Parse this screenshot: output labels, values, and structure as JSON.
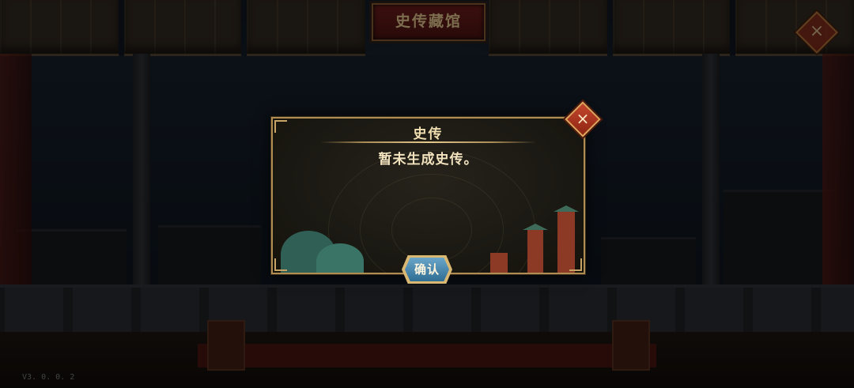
{
  "header": {
    "title": "史传藏馆"
  },
  "dialog": {
    "title": "史传",
    "message": "暂未生成史传。",
    "confirm_label": "确认",
    "close_label": "×"
  },
  "page_close_label": "×",
  "footer": {
    "version": "V3. 0. 0. 2"
  },
  "colors": {
    "dialog_border": "#b08d52",
    "confirm_button": "#3f82ab",
    "close_button": "#b63a22",
    "title_text": "#f1dfb2"
  }
}
